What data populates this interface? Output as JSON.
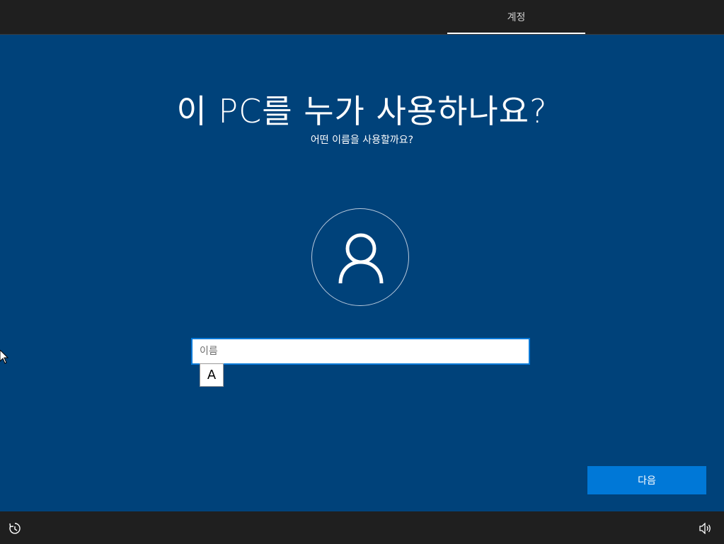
{
  "header": {
    "tab_label": "계정"
  },
  "main": {
    "title": "이 PC를 누가 사용하나요?",
    "subtitle": "어떤 이름을 사용할까요?",
    "avatar_icon": "user-icon",
    "name_input": {
      "placeholder": "이름",
      "value": ""
    },
    "ime_mode": "A",
    "next_label": "다음"
  },
  "footer": {
    "left_icon": "ease-of-access-icon",
    "right_icon": "volume-icon"
  },
  "colors": {
    "background": "#00427a",
    "accent": "#0078d7",
    "bar": "#1f1f1f"
  }
}
